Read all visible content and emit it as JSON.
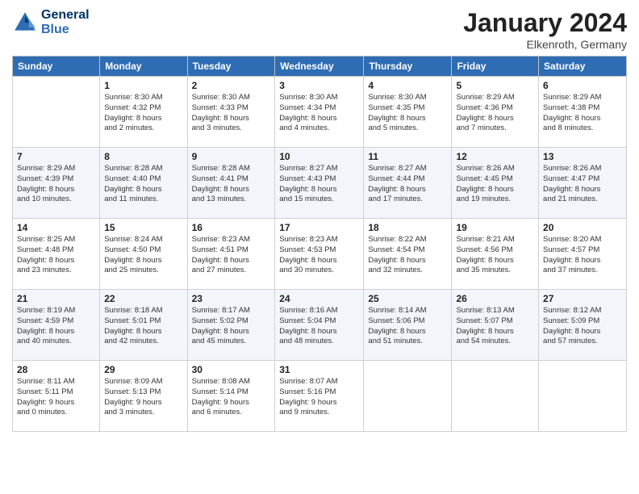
{
  "header": {
    "logo_line1": "General",
    "logo_line2": "Blue",
    "month_year": "January 2024",
    "location": "Elkenroth, Germany"
  },
  "weekdays": [
    "Sunday",
    "Monday",
    "Tuesday",
    "Wednesday",
    "Thursday",
    "Friday",
    "Saturday"
  ],
  "weeks": [
    [
      {
        "day": "",
        "info": ""
      },
      {
        "day": "1",
        "info": "Sunrise: 8:30 AM\nSunset: 4:32 PM\nDaylight: 8 hours\nand 2 minutes."
      },
      {
        "day": "2",
        "info": "Sunrise: 8:30 AM\nSunset: 4:33 PM\nDaylight: 8 hours\nand 3 minutes."
      },
      {
        "day": "3",
        "info": "Sunrise: 8:30 AM\nSunset: 4:34 PM\nDaylight: 8 hours\nand 4 minutes."
      },
      {
        "day": "4",
        "info": "Sunrise: 8:30 AM\nSunset: 4:35 PM\nDaylight: 8 hours\nand 5 minutes."
      },
      {
        "day": "5",
        "info": "Sunrise: 8:29 AM\nSunset: 4:36 PM\nDaylight: 8 hours\nand 7 minutes."
      },
      {
        "day": "6",
        "info": "Sunrise: 8:29 AM\nSunset: 4:38 PM\nDaylight: 8 hours\nand 8 minutes."
      }
    ],
    [
      {
        "day": "7",
        "info": "Sunrise: 8:29 AM\nSunset: 4:39 PM\nDaylight: 8 hours\nand 10 minutes."
      },
      {
        "day": "8",
        "info": "Sunrise: 8:28 AM\nSunset: 4:40 PM\nDaylight: 8 hours\nand 11 minutes."
      },
      {
        "day": "9",
        "info": "Sunrise: 8:28 AM\nSunset: 4:41 PM\nDaylight: 8 hours\nand 13 minutes."
      },
      {
        "day": "10",
        "info": "Sunrise: 8:27 AM\nSunset: 4:43 PM\nDaylight: 8 hours\nand 15 minutes."
      },
      {
        "day": "11",
        "info": "Sunrise: 8:27 AM\nSunset: 4:44 PM\nDaylight: 8 hours\nand 17 minutes."
      },
      {
        "day": "12",
        "info": "Sunrise: 8:26 AM\nSunset: 4:45 PM\nDaylight: 8 hours\nand 19 minutes."
      },
      {
        "day": "13",
        "info": "Sunrise: 8:26 AM\nSunset: 4:47 PM\nDaylight: 8 hours\nand 21 minutes."
      }
    ],
    [
      {
        "day": "14",
        "info": "Sunrise: 8:25 AM\nSunset: 4:48 PM\nDaylight: 8 hours\nand 23 minutes."
      },
      {
        "day": "15",
        "info": "Sunrise: 8:24 AM\nSunset: 4:50 PM\nDaylight: 8 hours\nand 25 minutes."
      },
      {
        "day": "16",
        "info": "Sunrise: 8:23 AM\nSunset: 4:51 PM\nDaylight: 8 hours\nand 27 minutes."
      },
      {
        "day": "17",
        "info": "Sunrise: 8:23 AM\nSunset: 4:53 PM\nDaylight: 8 hours\nand 30 minutes."
      },
      {
        "day": "18",
        "info": "Sunrise: 8:22 AM\nSunset: 4:54 PM\nDaylight: 8 hours\nand 32 minutes."
      },
      {
        "day": "19",
        "info": "Sunrise: 8:21 AM\nSunset: 4:56 PM\nDaylight: 8 hours\nand 35 minutes."
      },
      {
        "day": "20",
        "info": "Sunrise: 8:20 AM\nSunset: 4:57 PM\nDaylight: 8 hours\nand 37 minutes."
      }
    ],
    [
      {
        "day": "21",
        "info": "Sunrise: 8:19 AM\nSunset: 4:59 PM\nDaylight: 8 hours\nand 40 minutes."
      },
      {
        "day": "22",
        "info": "Sunrise: 8:18 AM\nSunset: 5:01 PM\nDaylight: 8 hours\nand 42 minutes."
      },
      {
        "day": "23",
        "info": "Sunrise: 8:17 AM\nSunset: 5:02 PM\nDaylight: 8 hours\nand 45 minutes."
      },
      {
        "day": "24",
        "info": "Sunrise: 8:16 AM\nSunset: 5:04 PM\nDaylight: 8 hours\nand 48 minutes."
      },
      {
        "day": "25",
        "info": "Sunrise: 8:14 AM\nSunset: 5:06 PM\nDaylight: 8 hours\nand 51 minutes."
      },
      {
        "day": "26",
        "info": "Sunrise: 8:13 AM\nSunset: 5:07 PM\nDaylight: 8 hours\nand 54 minutes."
      },
      {
        "day": "27",
        "info": "Sunrise: 8:12 AM\nSunset: 5:09 PM\nDaylight: 8 hours\nand 57 minutes."
      }
    ],
    [
      {
        "day": "28",
        "info": "Sunrise: 8:11 AM\nSunset: 5:11 PM\nDaylight: 9 hours\nand 0 minutes."
      },
      {
        "day": "29",
        "info": "Sunrise: 8:09 AM\nSunset: 5:13 PM\nDaylight: 9 hours\nand 3 minutes."
      },
      {
        "day": "30",
        "info": "Sunrise: 8:08 AM\nSunset: 5:14 PM\nDaylight: 9 hours\nand 6 minutes."
      },
      {
        "day": "31",
        "info": "Sunrise: 8:07 AM\nSunset: 5:16 PM\nDaylight: 9 hours\nand 9 minutes."
      },
      {
        "day": "",
        "info": ""
      },
      {
        "day": "",
        "info": ""
      },
      {
        "day": "",
        "info": ""
      }
    ]
  ]
}
